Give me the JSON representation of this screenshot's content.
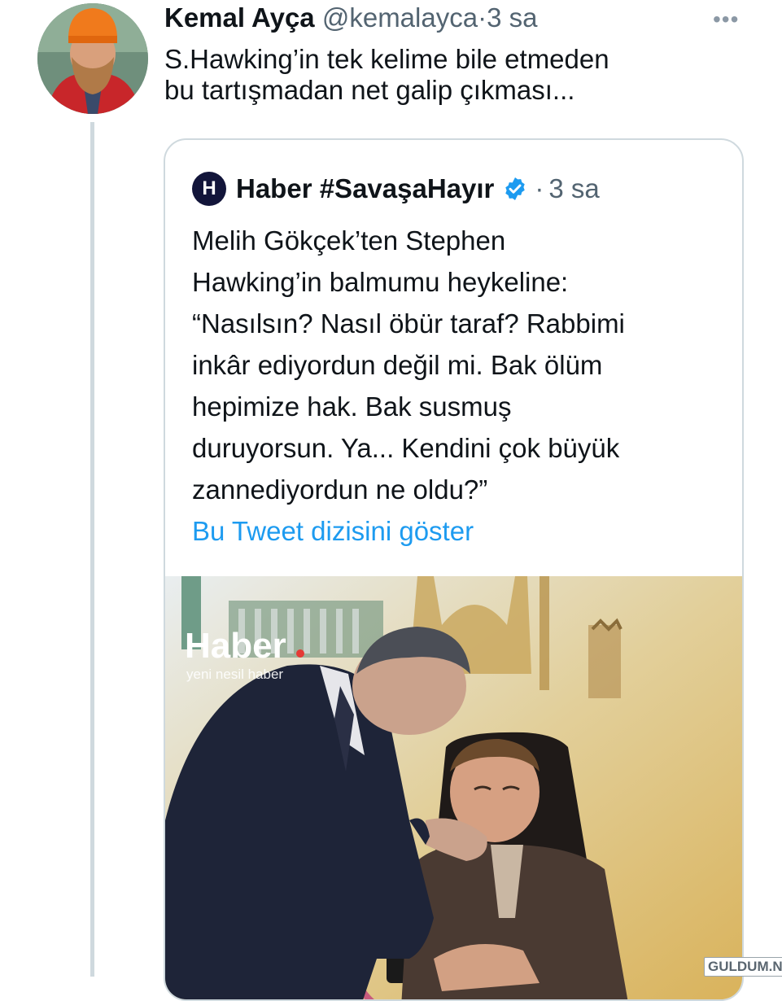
{
  "tweet": {
    "author_name": "Kemal Ayça",
    "author_handle": "@kemalayca",
    "separator": "·",
    "time": "3 sa",
    "more_icon": "more-dots-icon",
    "text_lines": [
      "S.Hawking’in tek kelime bile etmeden",
      "bu tartışmadan net galip çıkması..."
    ]
  },
  "quote": {
    "logo_letter": "H",
    "name": "Haber #SavaşaHayır",
    "verified_icon": "verified-badge-icon",
    "separator": "·",
    "time": "3 sa",
    "text_lines": [
      "Melih Gökçek’ten Stephen",
      "Hawking’in balmumu heykeline:",
      "“Nasılsın? Nasıl öbür taraf? Rabbimi",
      "inkâr ediyordun değil mi. Bak ölüm",
      "hepimize hak. Bak susmuş",
      "duruyorsun. Ya... Kendini çok büyük",
      "zannediyordun ne oldu?”"
    ],
    "show_thread_link": "Bu Tweet dizisini göster",
    "media": {
      "logo": "Haber",
      "tagline": "yeni nesil haber"
    }
  },
  "watermark": "GULDUM.NET",
  "colors": {
    "link": "#1d9bf0",
    "verified": "#1d9bf0",
    "secondary_text": "#536471",
    "border": "#cfd9de"
  }
}
